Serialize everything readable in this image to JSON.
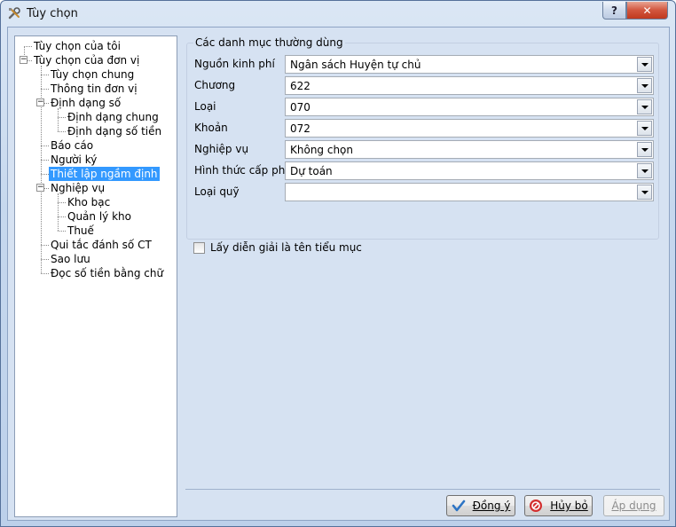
{
  "window": {
    "title": "Tùy chọn",
    "help_label": "?",
    "close_label": "✕"
  },
  "tree": [
    {
      "label": "Tùy chọn của tôi"
    },
    {
      "label": "Tùy chọn của đơn vị",
      "expander": "−"
    },
    {
      "label": "Tùy chọn chung"
    },
    {
      "label": "Thông tin đơn vị"
    },
    {
      "label": "Định dạng số",
      "expander": "−"
    },
    {
      "label": "Định dạng chung"
    },
    {
      "label": "Định dạng số tiền"
    },
    {
      "label": "Báo cáo"
    },
    {
      "label": "Người ký"
    },
    {
      "label": "Thiết lập ngầm định",
      "selected": true
    },
    {
      "label": "Nghiệp vụ",
      "expander": "−"
    },
    {
      "label": "Kho bạc"
    },
    {
      "label": "Quản lý kho"
    },
    {
      "label": "Thuế"
    },
    {
      "label": "Qui tắc đánh số CT"
    },
    {
      "label": "Sao lưu"
    },
    {
      "label": "Đọc số tiền bằng chữ"
    }
  ],
  "form": {
    "group_title": "Các danh mục thường dùng",
    "fields": [
      {
        "label": "Nguồn kinh phí",
        "value": "Ngân sách Huyện tự chủ"
      },
      {
        "label": "Chương",
        "value": "622"
      },
      {
        "label": "Loại",
        "value": "070"
      },
      {
        "label": "Khoản",
        "value": "072"
      },
      {
        "label": "Nghiệp vụ",
        "value": "Không chọn"
      },
      {
        "label": "Hình thức cấp phát",
        "value": "Dự toán"
      },
      {
        "label": "Loại quỹ",
        "value": ""
      }
    ],
    "checkbox_label": "Lấy diễn giải là tên tiểu mục",
    "checkbox_checked": false
  },
  "buttons": {
    "ok": {
      "label": "Đồng ý"
    },
    "cancel": {
      "label": "Hủy bỏ"
    },
    "apply": {
      "label": "Áp dụng",
      "enabled": false
    }
  },
  "colors": {
    "selection": "#3399ff",
    "ok_icon": "#2d74c4",
    "cancel_icon": "#d32f2f"
  }
}
